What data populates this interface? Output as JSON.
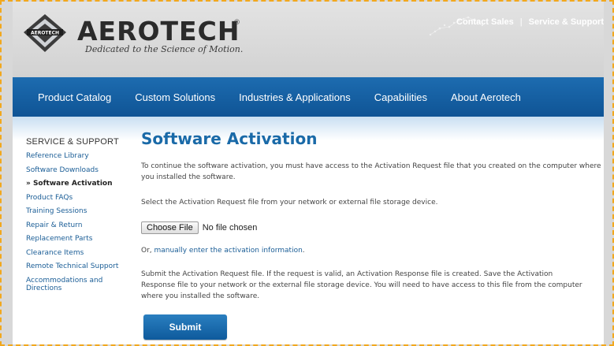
{
  "brand": {
    "logo_small": "AEROTECH",
    "name": "AEROTECH",
    "registered": "®",
    "tagline": "Dedicated to the Science of Motion."
  },
  "top_links": {
    "contact": "Contact Sales",
    "separator": "|",
    "service": "Service & Support"
  },
  "nav": {
    "items": [
      "Product Catalog",
      "Custom Solutions",
      "Industries & Applications",
      "Capabilities",
      "About Aerotech"
    ]
  },
  "sidebar": {
    "title": "SERVICE & SUPPORT",
    "items": [
      "Reference Library",
      "Software Downloads",
      "» Software Activation",
      "Product FAQs",
      "Training Sessions",
      "Repair & Return",
      "Replacement Parts",
      "Clearance Items",
      "Remote Technical Support",
      "Accommodations and Directions"
    ]
  },
  "main": {
    "title": "Software Activation",
    "intro": "To continue the software activation, you must have access to the Activation Request file that you created on the computer where you installed the software.",
    "select_prompt": "Select the Activation Request file from your network or external file storage device.",
    "file_button": "Choose File",
    "file_status": "No file chosen",
    "or_prefix": "Or, ",
    "manual_link": "manually enter the activation information",
    "or_suffix": ".",
    "submit_info": "Submit the Activation Request file. If the request is valid, an Activation Response file is created. Save the Activation Response file to your network or the external file storage device. You will need to have access to this file from the computer where you installed the software.",
    "submit_label": "Submit"
  },
  "colors": {
    "accent": "#1a6aa8",
    "nav_bg": "#145fa3",
    "frame": "#f2a81d"
  }
}
